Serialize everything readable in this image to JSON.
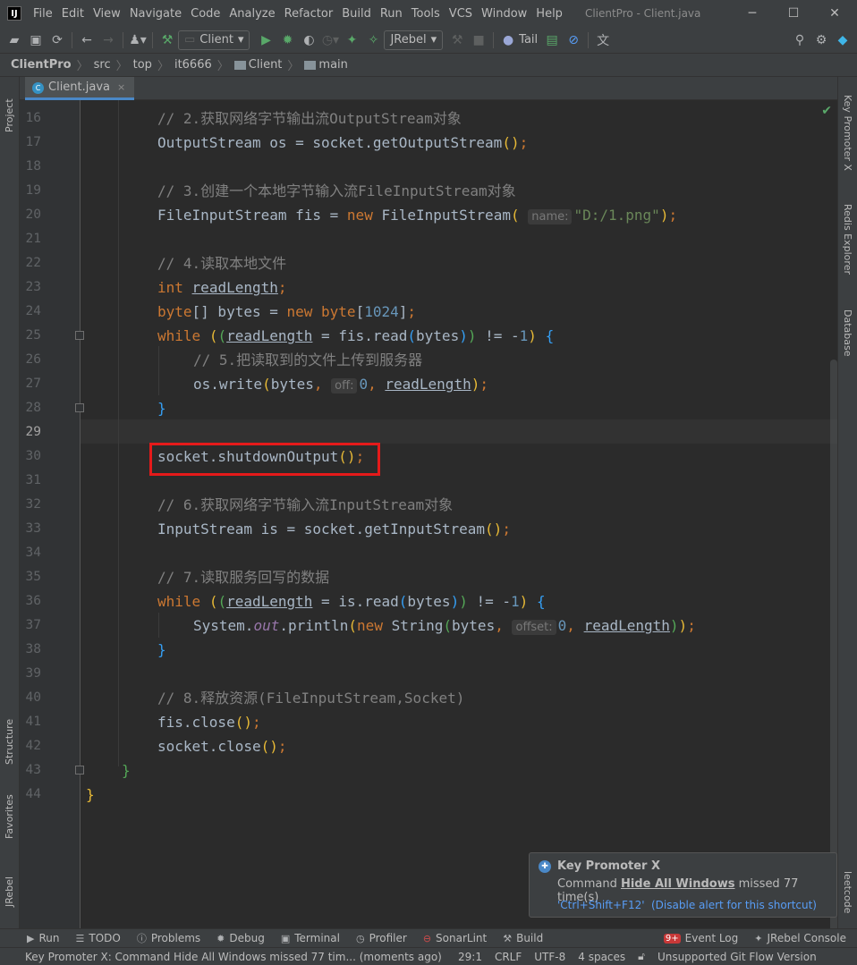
{
  "window": {
    "title": "ClientPro - Client.java",
    "logo": "IJ",
    "menu": [
      "File",
      "Edit",
      "View",
      "Navigate",
      "Code",
      "Analyze",
      "Refactor",
      "Build",
      "Run",
      "Tools",
      "VCS",
      "Window",
      "Help"
    ],
    "minimize": "─",
    "maximize": "☐",
    "close": "✕"
  },
  "toolbar": {
    "run_config": "Client",
    "jrebel_config": "JRebel",
    "tail_label": "Tail",
    "icons": [
      "open-folder-icon",
      "save-icon",
      "sync-icon",
      "back-icon",
      "forward-icon",
      "user-icon",
      "build-hammer-icon",
      "run-icon",
      "debug-icon",
      "coverage-icon",
      "profile-icon",
      "jrebel-run-icon",
      "jrebel-debug-icon",
      "stop-icon",
      "tail-icon",
      "monitor-icon",
      "no-entry-icon",
      "translate-icon",
      "search-icon",
      "settings-icon",
      "plugin-icon"
    ]
  },
  "breadcrumb": [
    "ClientPro",
    "src",
    "top",
    "it6666",
    "Client",
    "main"
  ],
  "tab": {
    "label": "Client.java",
    "close": "×"
  },
  "left_strip": {
    "project": "Project",
    "structure": "Structure",
    "favorites": "Favorites",
    "jrebel": "JRebel"
  },
  "right_strip": {
    "key_promoter": "Key Promoter X",
    "redis": "Redis Explorer",
    "database": "Database",
    "leetcode": "leetcode"
  },
  "editor": {
    "line_numbers": [
      "16",
      "17",
      "18",
      "19",
      "20",
      "21",
      "22",
      "23",
      "24",
      "25",
      "26",
      "27",
      "28",
      "29",
      "30",
      "31",
      "32",
      "33",
      "34",
      "35",
      "36",
      "37",
      "38",
      "39",
      "40",
      "41",
      "42",
      "43",
      "44"
    ],
    "current_line": "29",
    "hint_name": "name:",
    "hint_off": "off:",
    "hint_offset": "offset:",
    "line16_comment": "// 2.获取网络字节输出流OutputStream对象",
    "line19_comment": "// 3.创建一个本地字节输入流FileInputStream对象",
    "line22_comment": "// 4.读取本地文件",
    "line26_comment": "// 5.把读取到的文件上传到服务器",
    "line32_comment": "// 6.获取网络字节输入流InputStream对象",
    "line35_comment": "// 7.读取服务回写的数据",
    "line40_comment": "// 8.释放资源(FileInputStream,Socket)",
    "string_path": "\"D:/1.png\""
  },
  "notification": {
    "title": "Key Promoter X",
    "msg_prefix": "Command ",
    "msg_cmd": "Hide All Windows",
    "msg_suffix": " missed 77 time(s)",
    "shortcut": "'Ctrl+Shift+F12'",
    "disable": "(Disable alert for this shortcut)"
  },
  "bottom_tools": [
    "Run",
    "TODO",
    "Problems",
    "Debug",
    "Terminal",
    "Profiler",
    "SonarLint",
    "Build",
    "Event Log",
    "JRebel Console"
  ],
  "event_badge": "9+",
  "status": {
    "message": "Key Promoter X: Command Hide All Windows missed 77 tim... (moments ago)",
    "position": "29:1",
    "line_sep": "CRLF",
    "encoding": "UTF-8",
    "indent": "4 spaces",
    "git": "Unsupported Git Flow Version"
  },
  "colors": {
    "highlight_box": "#e51a1a",
    "keyword": "#cc7832",
    "comment": "#808080",
    "number": "#6897bb",
    "string": "#6a8759"
  }
}
